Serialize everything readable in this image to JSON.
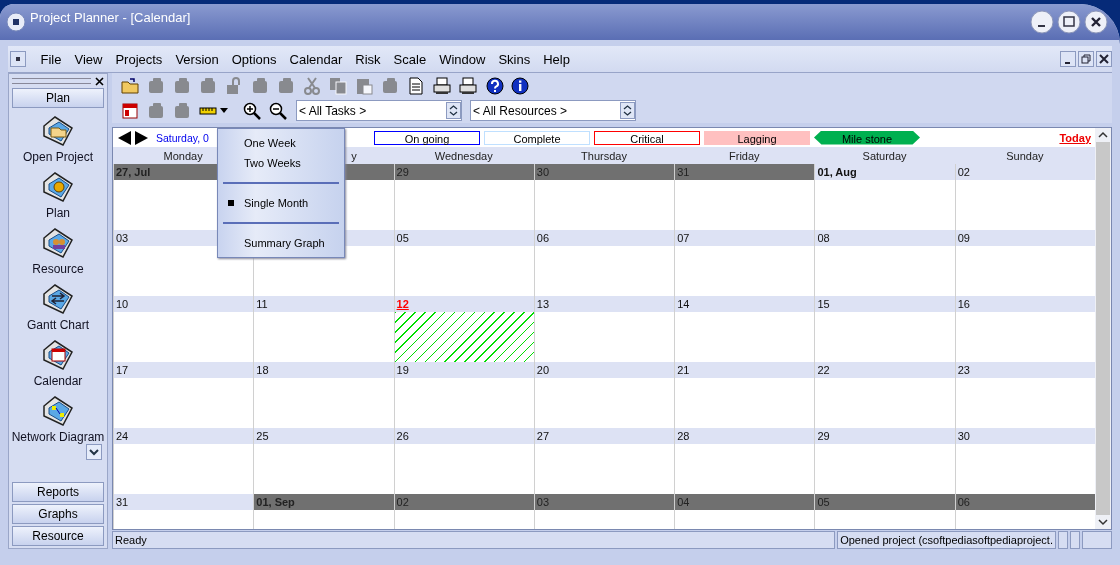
{
  "window": {
    "title": "Project Planner - [Calendar]"
  },
  "menu": [
    "File",
    "View",
    "Projects",
    "Version",
    "Options",
    "Calendar",
    "Risk",
    "Scale",
    "Window",
    "Skins",
    "Help"
  ],
  "sidebar": {
    "header": "Plan",
    "items": [
      {
        "label": "Open Project",
        "kind": "open"
      },
      {
        "label": "Plan",
        "kind": "plan"
      },
      {
        "label": "Resource",
        "kind": "resource"
      },
      {
        "label": "Gantt Chart",
        "kind": "gantt"
      },
      {
        "label": "Calendar",
        "kind": "calendar"
      },
      {
        "label": "Network Diagram",
        "kind": "network"
      }
    ],
    "buttons": [
      "Reports",
      "Graphs",
      "Resource"
    ]
  },
  "toolbar_1": [
    {
      "kind": "folder",
      "disabled": false
    },
    {
      "kind": "block",
      "disabled": true
    },
    {
      "kind": "block",
      "disabled": true
    },
    {
      "kind": "block",
      "disabled": true
    },
    {
      "kind": "lock",
      "disabled": true
    },
    {
      "kind": "block",
      "disabled": true
    },
    {
      "kind": "block",
      "disabled": true
    },
    {
      "kind": "scissors",
      "disabled": true
    },
    {
      "kind": "copy",
      "disabled": true
    },
    {
      "kind": "paste",
      "disabled": true
    },
    {
      "kind": "block",
      "disabled": true
    },
    {
      "kind": "document",
      "disabled": false
    },
    {
      "kind": "printer",
      "disabled": false
    },
    {
      "kind": "printer",
      "disabled": false
    },
    {
      "kind": "help",
      "disabled": false
    },
    {
      "kind": "info",
      "disabled": false
    }
  ],
  "toolbar_2": [
    {
      "kind": "calendar",
      "disabled": false
    },
    {
      "kind": "block",
      "disabled": true
    },
    {
      "kind": "block",
      "disabled": true
    },
    {
      "kind": "ruler",
      "disabled": false
    },
    {
      "kind": "zoom_in",
      "disabled": false
    },
    {
      "kind": "zoom_out",
      "disabled": false
    }
  ],
  "task_filter": {
    "value": "< All Tasks >"
  },
  "resource_filter": {
    "value": "< All Resources >"
  },
  "nav_date": "Saturday, 0",
  "legend": [
    {
      "label": "On going",
      "kind": "outline",
      "color": "#0000ff"
    },
    {
      "label": "Complete",
      "kind": "outline",
      "color": "#c0e0ff"
    },
    {
      "label": "Critical",
      "kind": "outline",
      "color": "#ff0000"
    },
    {
      "label": "Lagging",
      "kind": "fill",
      "color": "#ffc0c0"
    },
    {
      "label": "Mile stone",
      "kind": "milestone",
      "color": "#00b050"
    }
  ],
  "today_link": "Today",
  "days": [
    {
      "label": "Monday",
      "covered": false
    },
    {
      "label": "y",
      "covered": true
    },
    {
      "label": "Wednesday",
      "covered": false
    },
    {
      "label": "Thursday",
      "covered": false
    },
    {
      "label": "Friday",
      "covered": false
    },
    {
      "label": "Saturday",
      "covered": false
    },
    {
      "label": "Sunday",
      "covered": false
    }
  ],
  "weeks": [
    [
      {
        "date": "27, Jul",
        "kind": "outside_start"
      },
      {
        "kind": "outside"
      },
      {
        "date": "29",
        "kind": "outside"
      },
      {
        "date": "30",
        "kind": "outside"
      },
      {
        "date": "31",
        "kind": "outside"
      },
      {
        "date": "01, Aug",
        "kind": "month_start"
      },
      {
        "date": "02",
        "kind": "day"
      }
    ],
    [
      {
        "date": "03",
        "kind": "day"
      },
      {
        "kind": "day"
      },
      {
        "date": "05",
        "kind": "day"
      },
      {
        "date": "06",
        "kind": "day"
      },
      {
        "date": "07",
        "kind": "day"
      },
      {
        "date": "08",
        "kind": "day"
      },
      {
        "date": "09",
        "kind": "day"
      }
    ],
    [
      {
        "date": "10",
        "kind": "day"
      },
      {
        "date": "11",
        "kind": "day"
      },
      {
        "date": "12",
        "kind": "today"
      },
      {
        "date": "13",
        "kind": "day"
      },
      {
        "date": "14",
        "kind": "day"
      },
      {
        "date": "15",
        "kind": "day"
      },
      {
        "date": "16",
        "kind": "day"
      }
    ],
    [
      {
        "date": "17",
        "kind": "day"
      },
      {
        "date": "18",
        "kind": "day"
      },
      {
        "date": "19",
        "kind": "day"
      },
      {
        "date": "20",
        "kind": "day"
      },
      {
        "date": "21",
        "kind": "day"
      },
      {
        "date": "22",
        "kind": "day"
      },
      {
        "date": "23",
        "kind": "day"
      }
    ],
    [
      {
        "date": "24",
        "kind": "day"
      },
      {
        "date": "25",
        "kind": "day"
      },
      {
        "date": "26",
        "kind": "day"
      },
      {
        "date": "27",
        "kind": "day"
      },
      {
        "date": "28",
        "kind": "day"
      },
      {
        "date": "29",
        "kind": "day"
      },
      {
        "date": "30",
        "kind": "day"
      }
    ],
    [
      {
        "date": "31",
        "kind": "day"
      },
      {
        "date": "01, Sep",
        "kind": "outside_start"
      },
      {
        "date": "02",
        "kind": "outside"
      },
      {
        "date": "03",
        "kind": "outside"
      },
      {
        "date": "04",
        "kind": "outside"
      },
      {
        "date": "05",
        "kind": "outside"
      },
      {
        "date": "06",
        "kind": "outside"
      }
    ]
  ],
  "view_menu": [
    {
      "kind": "item",
      "label": "One Week",
      "selected": false
    },
    {
      "kind": "item",
      "label": "Two Weeks",
      "selected": false
    },
    {
      "kind": "separator"
    },
    {
      "kind": "item",
      "label": "Single Month",
      "selected": true
    },
    {
      "kind": "separator"
    },
    {
      "kind": "item",
      "label": "Summary Graph",
      "selected": false
    }
  ],
  "status_bar": {
    "left": "Ready",
    "right": "Opened project (csoftpediasoftpediaproject."
  }
}
